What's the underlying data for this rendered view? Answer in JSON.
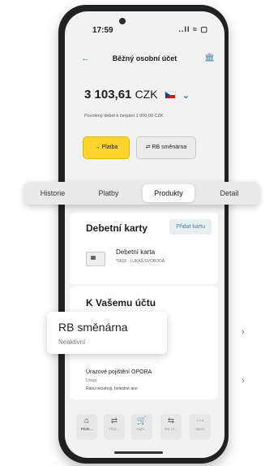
{
  "status": {
    "time": "17:59",
    "signal": "..ll ≈ ▢"
  },
  "nav": {
    "back_icon": "←",
    "title": "Běžný osobní účet",
    "bank_icon": "🏛"
  },
  "account": {
    "amount": "3 103,61",
    "currency": "CZK",
    "overdraft": "Povolený debet k čerpání 1 000,00 CZK"
  },
  "actions": {
    "pay": "→ Platba",
    "exchange": "⇄ RB směnárna"
  },
  "tabs": [
    "Historie",
    "Platby",
    "Produkty",
    "Detail"
  ],
  "debit": {
    "title": "Debetní karty",
    "add": "Přidat kartu",
    "card_name": "Debetní karta",
    "card_number": "*5615 · LUKÁŠ SVOBODA"
  },
  "account_section": {
    "title": "K Vašemu účtu"
  },
  "popup": {
    "title": "RB směnárna",
    "status": "Neaktivní"
  },
  "insurance": {
    "title": "Úrazové pojištění OPORA",
    "provider": "Uniqa",
    "note": "Ránu nezahojí, bolestné ano"
  },
  "bottom_nav": [
    {
      "icon": "⌂",
      "label": "Přehl..."
    },
    {
      "icon": "⇄",
      "label": "Plat..."
    },
    {
      "icon": "🛒",
      "label": "Nabí..."
    },
    {
      "icon": "⇆",
      "label": "RB Cl..."
    },
    {
      "icon": "⋯",
      "label": "Menu"
    }
  ],
  "colors": {
    "accent": "#ffd42d",
    "link": "#4c7f9b"
  }
}
